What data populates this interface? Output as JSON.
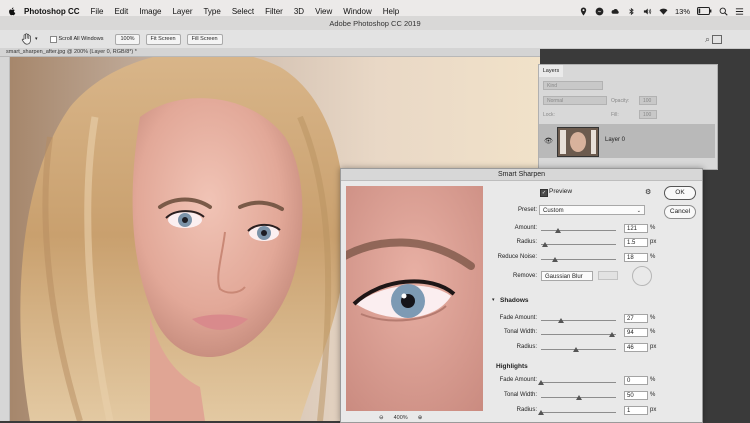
{
  "menubar": {
    "items": [
      "Photoshop CC",
      "File",
      "Edit",
      "Image",
      "Layer",
      "Type",
      "Select",
      "Filter",
      "3D",
      "View",
      "Window",
      "Help"
    ],
    "battery": "13%",
    "status_icons": [
      "location-icon",
      "messenger-icon",
      "creative-cloud-icon",
      "bluetooth-icon",
      "volume-icon",
      "wifi-icon",
      "battery-icon",
      "spotlight-icon",
      "notification-icon"
    ]
  },
  "window": {
    "title": "Adobe Photoshop CC 2019"
  },
  "options": {
    "scroll_all": "Scroll All Windows",
    "zoom": "100%",
    "fit_screen": "Fit Screen",
    "fill_screen": "Fill Screen"
  },
  "document": {
    "tab": "smart_sharpen_after.jpg @ 200% (Layer 0, RGB/8*) *"
  },
  "layers": {
    "title": "Layers",
    "kind_placeholder": "Kind",
    "mode": "Normal",
    "opacity_label": "Opacity:",
    "opacity_value": "100",
    "lock_label": "Lock:",
    "fill_label": "Fill:",
    "fill_value": "100",
    "layer_name": "Layer 0"
  },
  "dialog": {
    "title": "Smart Sharpen",
    "preview_label": "Preview",
    "ok": "OK",
    "cancel": "Cancel",
    "preset_label": "Preset:",
    "preset_value": "Custom",
    "amount_label": "Amount:",
    "amount_value": "121",
    "amount_unit": "%",
    "radius_label": "Radius:",
    "radius_value": "1.5",
    "radius_unit": "px",
    "noise_label": "Reduce Noise:",
    "noise_value": "18",
    "noise_unit": "%",
    "remove_label": "Remove:",
    "remove_value": "Gaussian Blur",
    "shadows_title": "Shadows",
    "sh_fade_label": "Fade Amount:",
    "sh_fade_value": "27",
    "sh_fade_unit": "%",
    "sh_tonal_label": "Tonal Width:",
    "sh_tonal_value": "94",
    "sh_tonal_unit": "%",
    "sh_radius_label": "Radius:",
    "sh_radius_value": "46",
    "sh_radius_unit": "px",
    "highlights_title": "Highlights",
    "hl_fade_label": "Fade Amount:",
    "hl_fade_value": "0",
    "hl_fade_unit": "%",
    "hl_tonal_label": "Tonal Width:",
    "hl_tonal_value": "50",
    "hl_tonal_unit": "%",
    "hl_radius_label": "Radius:",
    "hl_radius_value": "1",
    "hl_radius_unit": "px",
    "zoom_level": "400%",
    "zoom_out": "⊖",
    "zoom_in": "⊕"
  },
  "slider_levels": {
    "amount": 0.22,
    "radius": 0.05,
    "noise": 0.18,
    "sh_fade": 0.27,
    "sh_tonal": 0.94,
    "sh_radius": 0.46,
    "hl_fade": 0.0,
    "hl_tonal": 0.5,
    "hl_radius": 0.0
  }
}
